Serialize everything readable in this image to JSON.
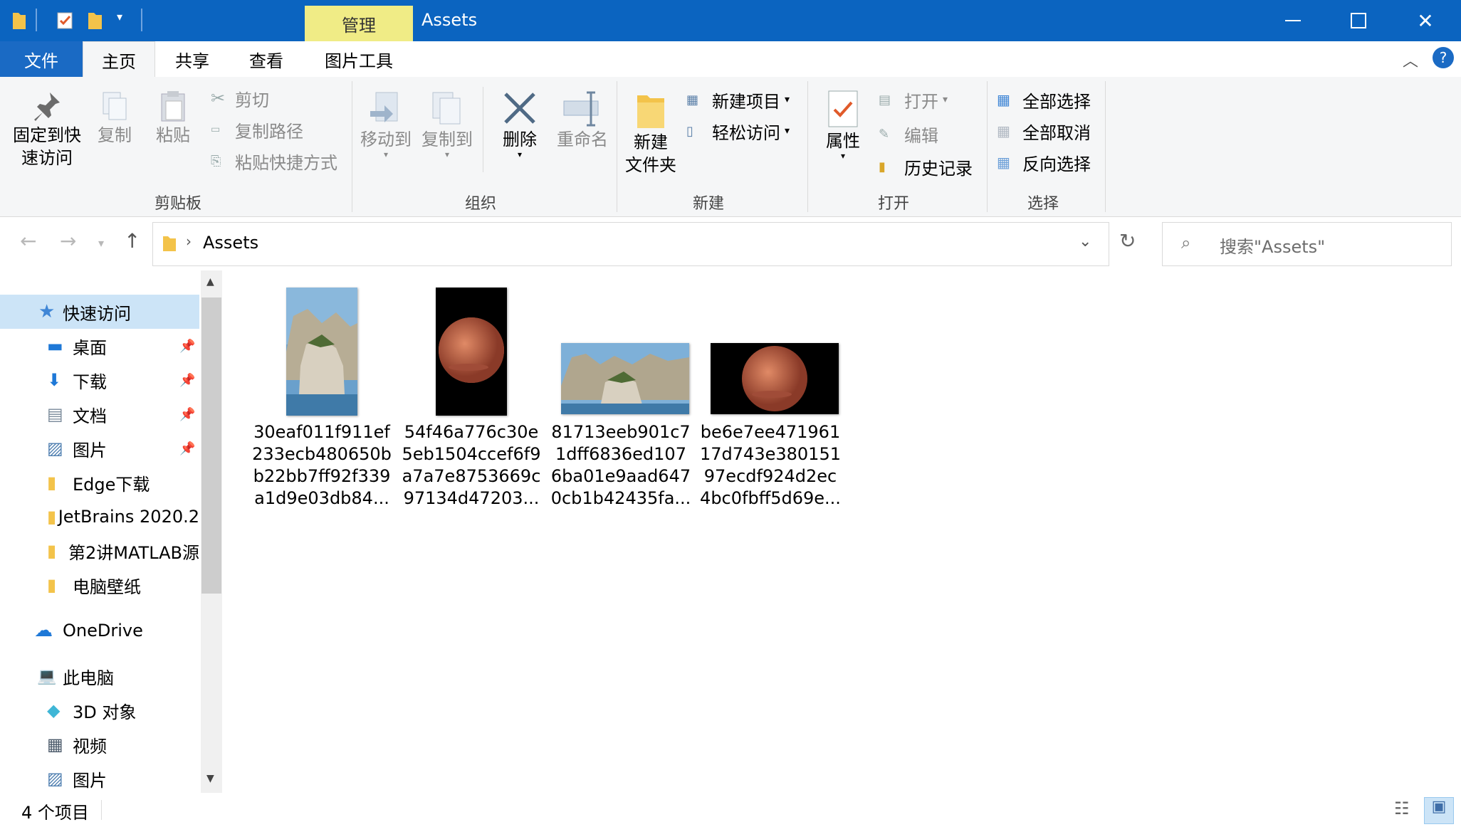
{
  "window": {
    "title": "Assets",
    "manage_tab": "管理"
  },
  "tabs": {
    "file": "文件",
    "home": "主页",
    "share": "共享",
    "view": "查看",
    "picture_tools": "图片工具"
  },
  "ribbon": {
    "clipboard": {
      "label": "剪贴板",
      "pin_quick_line1": "固定到快",
      "pin_quick_line2": "速访问",
      "copy": "复制",
      "paste": "粘贴",
      "cut": "剪切",
      "copy_path": "复制路径",
      "paste_shortcut": "粘贴快捷方式"
    },
    "organize": {
      "label": "组织",
      "move_to": "移动到",
      "copy_to": "复制到",
      "delete": "删除",
      "rename": "重命名"
    },
    "new": {
      "label": "新建",
      "new_folder_line1": "新建",
      "new_folder_line2": "文件夹",
      "new_item": "新建项目",
      "easy_access": "轻松访问"
    },
    "open": {
      "label": "打开",
      "properties": "属性",
      "open": "打开",
      "edit": "编辑",
      "history": "历史记录"
    },
    "select": {
      "label": "选择",
      "select_all": "全部选择",
      "select_none": "全部取消",
      "invert_selection": "反向选择"
    }
  },
  "address": {
    "path": "Assets",
    "search_placeholder": "搜索\"Assets\""
  },
  "nav": {
    "quick_access": "快速访问",
    "items": [
      {
        "label": "桌面",
        "pinned": true,
        "icon": "desktop-icon"
      },
      {
        "label": "下载",
        "pinned": true,
        "icon": "download-icon"
      },
      {
        "label": "文档",
        "pinned": true,
        "icon": "document-icon"
      },
      {
        "label": "图片",
        "pinned": true,
        "icon": "pictures-icon"
      },
      {
        "label": "Edge下载",
        "pinned": false,
        "icon": "folder-icon"
      },
      {
        "label": "JetBrains 2020.2",
        "pinned": false,
        "icon": "folder-icon"
      },
      {
        "label": "第2讲MATLAB源",
        "pinned": false,
        "icon": "folder-icon"
      },
      {
        "label": "电脑壁纸",
        "pinned": false,
        "icon": "folder-icon"
      }
    ],
    "onedrive": "OneDrive",
    "this_pc": "此电脑",
    "pc_items": [
      {
        "label": "3D 对象",
        "icon": "3d-objects-icon"
      },
      {
        "label": "视频",
        "icon": "video-icon"
      },
      {
        "label": "图片",
        "icon": "pictures-icon"
      }
    ]
  },
  "files": [
    {
      "name_lines": [
        "30eaf011f911ef",
        "233ecb480650b",
        "b22bb7ff92f339",
        "a1d9e03db84..."
      ],
      "kind": "rock-portrait"
    },
    {
      "name_lines": [
        "54f46a776c30e",
        "5eb1504ccef6f9",
        "a7a7e8753669c",
        "97134d47203..."
      ],
      "kind": "mars-portrait"
    },
    {
      "name_lines": [
        "81713eeb901c7",
        "1dff6836ed107",
        "6ba01e9aad647",
        "0cb1b42435fa..."
      ],
      "kind": "rock-landscape"
    },
    {
      "name_lines": [
        "be6e7ee471961",
        "17d743e380151",
        "97ecdf924d2ec",
        "4bc0fbff5d69e..."
      ],
      "kind": "mars-landscape"
    }
  ],
  "status": {
    "item_count": "4 个项目"
  },
  "colors": {
    "titlebar": "#0b64c0",
    "manage_tab": "#f0ec86",
    "file_tab": "#1a6ac4",
    "selection": "#cce4f7"
  }
}
